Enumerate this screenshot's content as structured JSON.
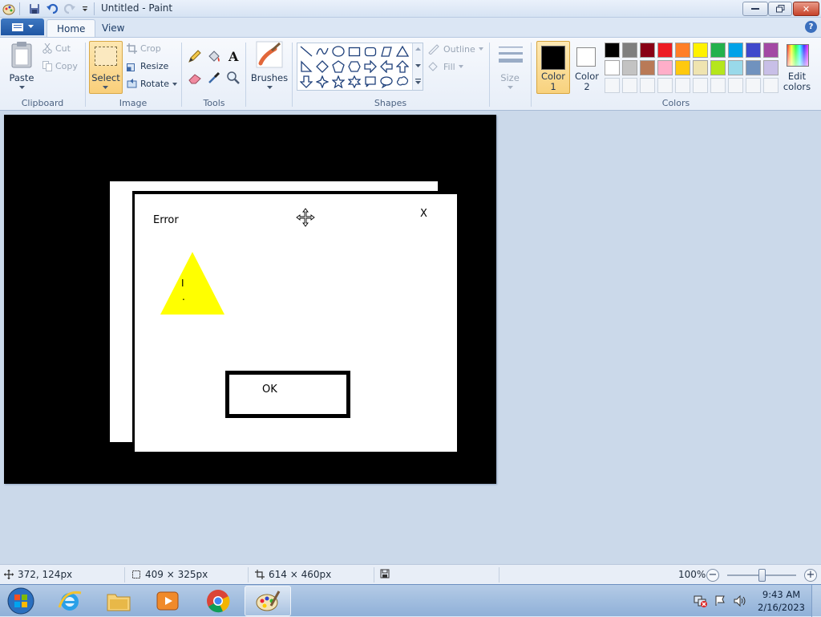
{
  "window": {
    "title": "Untitled - Paint",
    "controls": {
      "minimize": "▭",
      "restore": "❐",
      "close": "✕"
    }
  },
  "quick_access": [
    "paint-icon",
    "save-icon",
    "undo-icon",
    "redo-icon",
    "customize-dropdown-icon"
  ],
  "tabs": [
    {
      "label": "Home",
      "active": true
    },
    {
      "label": "View",
      "active": false
    }
  ],
  "help_icon": "?",
  "ribbon": {
    "clipboard": {
      "label": "Clipboard",
      "paste": "Paste",
      "cut": "Cut",
      "copy": "Copy"
    },
    "image": {
      "label": "Image",
      "select": "Select",
      "crop": "Crop",
      "resize": "Resize",
      "rotate": "Rotate"
    },
    "tools": {
      "label": "Tools"
    },
    "brushes": {
      "label": "Brushes"
    },
    "shapes": {
      "label": "Shapes",
      "outline": "Outline",
      "fill": "Fill"
    },
    "size": {
      "label": "Size"
    },
    "color1": {
      "line1": "Color",
      "line2": "1",
      "value": "#000000"
    },
    "color2": {
      "line1": "Color",
      "line2": "2",
      "value": "#ffffff"
    },
    "edit_colors": {
      "line1": "Edit",
      "line2": "colors"
    },
    "colors_label": "Colors",
    "palette_row1": [
      "#000000",
      "#7f7f7f",
      "#880015",
      "#ed1c24",
      "#ff7f27",
      "#fff200",
      "#22b14c",
      "#00a2e8",
      "#3f48cc",
      "#a349a4"
    ],
    "palette_row2": [
      "#ffffff",
      "#c3c3c3",
      "#b97a57",
      "#ffaec9",
      "#ffc90e",
      "#efe4b0",
      "#b5e61d",
      "#99d9ea",
      "#7092be",
      "#c8bfe7"
    ]
  },
  "canvas_drawing": {
    "dialog_title": "Error",
    "close_x": "X",
    "warning_glyph_top": "I",
    "warning_glyph_bottom": ".",
    "ok_label": "OK",
    "colors": {
      "background": "#000000",
      "dialog": "#ffffff",
      "warning": "#ffff00"
    }
  },
  "status": {
    "cursor_pos": "372, 124px",
    "selection_size": "409 × 325px",
    "image_size": "614 × 460px",
    "zoom": "100%",
    "zoom_minus": "−",
    "zoom_plus": "+",
    "zoom_fraction": 0.5
  },
  "taskbar": {
    "apps": [
      "start-orb",
      "internet-explorer-icon",
      "file-explorer-icon",
      "media-player-icon",
      "chrome-icon",
      "paint-icon"
    ],
    "time": "9:43 AM",
    "date": "2/16/2023"
  }
}
